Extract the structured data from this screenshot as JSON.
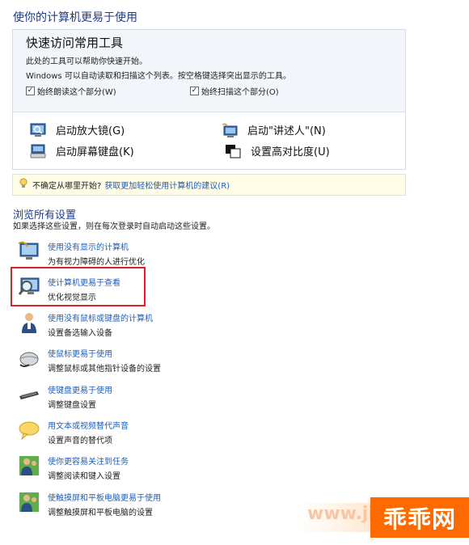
{
  "page_title": "使你的计算机更易于使用",
  "quick_access": {
    "heading": "快速访问常用工具",
    "desc_line1": "此处的工具可以帮助你快速开始。",
    "desc_line2": "Windows 可以自动读取和扫描这个列表。按空格键选择突出显示的工具。",
    "checkbox_read": "始终朗读这个部分(W)",
    "checkbox_scan": "始终扫描这个部分(O)",
    "tools": {
      "magnifier": "启动放大镜(G)",
      "narrator": "启动\"讲述人\"(N)",
      "osk": "启动屏幕键盘(K)",
      "high_contrast": "设置高对比度(U)"
    }
  },
  "tip": {
    "text": "不确定从哪里开始?",
    "link": "获取更加轻松使用计算机的建议(R)"
  },
  "browse": {
    "title": "浏览所有设置",
    "desc": "如果选择这些设置，则在每次登录时自动启动这些设置。",
    "items": [
      {
        "link": "使用没有显示的计算机",
        "desc": "为有视力障碍的人进行优化",
        "icon": "monitor-icon"
      },
      {
        "link": "使计算机更易于查看",
        "desc": "优化视觉显示",
        "icon": "magnifier-monitor-icon"
      },
      {
        "link": "使用没有鼠标或键盘的计算机",
        "desc": "设置备选输入设备",
        "icon": "person-icon"
      },
      {
        "link": "使鼠标更易于使用",
        "desc": "调整鼠标或其他指针设备的设置",
        "icon": "mouse-icon"
      },
      {
        "link": "使键盘更易于使用",
        "desc": "调整键盘设置",
        "icon": "keyboard-icon"
      },
      {
        "link": "用文本或视频替代声音",
        "desc": "设置声音的替代项",
        "icon": "speech-bubble-icon"
      },
      {
        "link": "使你更容易关注到任务",
        "desc": "调整阅读和键入设置",
        "icon": "people-icon"
      },
      {
        "link": "使触摸屏和平板电脑更易于使用",
        "desc": "调整触摸屏和平板电脑的设置",
        "icon": "people-icon"
      }
    ]
  },
  "watermark": {
    "url": "www.jis",
    "logo": "乖乖网"
  },
  "colors": {
    "link": "#1a5fc0",
    "heading": "#1e3c8c",
    "highlight": "#e21f26",
    "tip_bg": "#fffce6",
    "brand_orange": "#ff6a00"
  }
}
